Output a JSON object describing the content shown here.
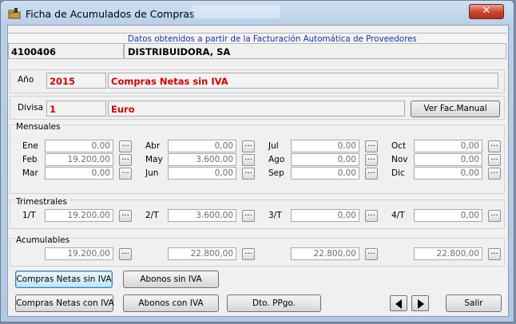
{
  "window": {
    "title": "Ficha de Acumulados de Compras",
    "close_label": "✕",
    "title_icon": "folder-hand-icon"
  },
  "header": {
    "info_text": "Datos obtenidos a partir de la Facturación Automática de Proveedores",
    "code": "4100406",
    "name": "DISTRIBUIDORA, SA"
  },
  "year": {
    "label": "Año",
    "value": "2015",
    "description": "Compras Netas sin IVA"
  },
  "currency": {
    "label": "Divisa",
    "value": "1",
    "description": "Euro",
    "button_label": "Ver Fac.Manual"
  },
  "dots_label": "...",
  "monthly": {
    "title": "Mensuales",
    "rows": [
      [
        {
          "label": "Ene",
          "value": "0,00"
        },
        {
          "label": "Abr",
          "value": "0,00"
        },
        {
          "label": "Jul",
          "value": "0,00"
        },
        {
          "label": "Oct",
          "value": "0,00"
        }
      ],
      [
        {
          "label": "Feb",
          "value": "19.200,00"
        },
        {
          "label": "May",
          "value": "3.600,00"
        },
        {
          "label": "Ago",
          "value": "0,00"
        },
        {
          "label": "Nov",
          "value": "0,00"
        }
      ],
      [
        {
          "label": "Mar",
          "value": "0,00"
        },
        {
          "label": "Jun",
          "value": "0,00"
        },
        {
          "label": "Sep",
          "value": "0,00"
        },
        {
          "label": "Dic",
          "value": "0,00"
        }
      ]
    ]
  },
  "quarterly": {
    "title": "Trimestrales",
    "items": [
      {
        "label": "1/T",
        "value": "19.200,00"
      },
      {
        "label": "2/T",
        "value": "3.600,00"
      },
      {
        "label": "3/T",
        "value": "0,00"
      },
      {
        "label": "4/T",
        "value": "0,00"
      }
    ]
  },
  "accumulated": {
    "title": "Acumulables",
    "values": [
      "19.200,00",
      "22.800,00",
      "22.800,00",
      "22.800,00"
    ]
  },
  "buttons": {
    "net_no_vat": "Compras Netas sin IVA",
    "credits_no_vat": "Abonos sin IVA",
    "net_with_vat": "Compras Netas con IVA",
    "credits_with_vat": "Abonos con IVA",
    "discount": "Dto. PPgo.",
    "exit": "Salir"
  },
  "colors": {
    "red_value": "#d40000",
    "info_blue": "#1c2fa8",
    "close_red": "#c8462b"
  }
}
